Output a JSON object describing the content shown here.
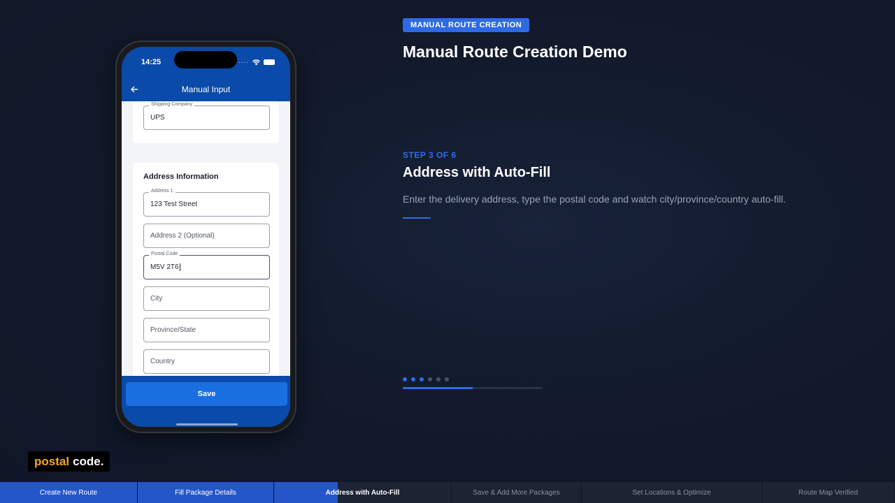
{
  "phone": {
    "time": "14:25",
    "app_title": "Manual Input",
    "card1": {
      "field_label": "Shipping Company",
      "field_value": "UPS"
    },
    "address_section": {
      "title": "Address Information",
      "address1_label": "Address 1",
      "address1_value": "123 Test Street",
      "address2_placeholder": "Address 2 (Optional)",
      "postal_label": "Postal Code",
      "postal_value": "M5V 2T6",
      "city_placeholder": "City",
      "province_placeholder": "Province/State",
      "country_placeholder": "Country"
    },
    "save_label": "Save"
  },
  "badge": "MANUAL ROUTE CREATION",
  "main_title": "Manual Route Creation Demo",
  "step": {
    "label": "STEP 3 OF 6",
    "title": "Address with Auto-Fill",
    "description": "Enter the delivery address, type the postal code and watch city/province/country auto-fill.",
    "current": 3,
    "total": 6,
    "progress_fraction": 0.5
  },
  "caption": {
    "highlight": "postal",
    "rest": "code."
  },
  "tabs": [
    {
      "label": "Create New Route",
      "state": "done"
    },
    {
      "label": "Fill Package Details",
      "state": "done"
    },
    {
      "label": "Address with Auto-Fill",
      "state": "active",
      "progress_fraction": 0.36
    },
    {
      "label": "Save & Add More Packages",
      "state": "pending"
    },
    {
      "label": "Set Locations & Optimize",
      "state": "pending"
    },
    {
      "label": "Route Map Verified",
      "state": "pending"
    }
  ],
  "colors": {
    "accent": "#2e6de8",
    "app_bar": "#0a4aa8",
    "save_button": "#1a6fe0",
    "caption_highlight": "#f5a623"
  }
}
